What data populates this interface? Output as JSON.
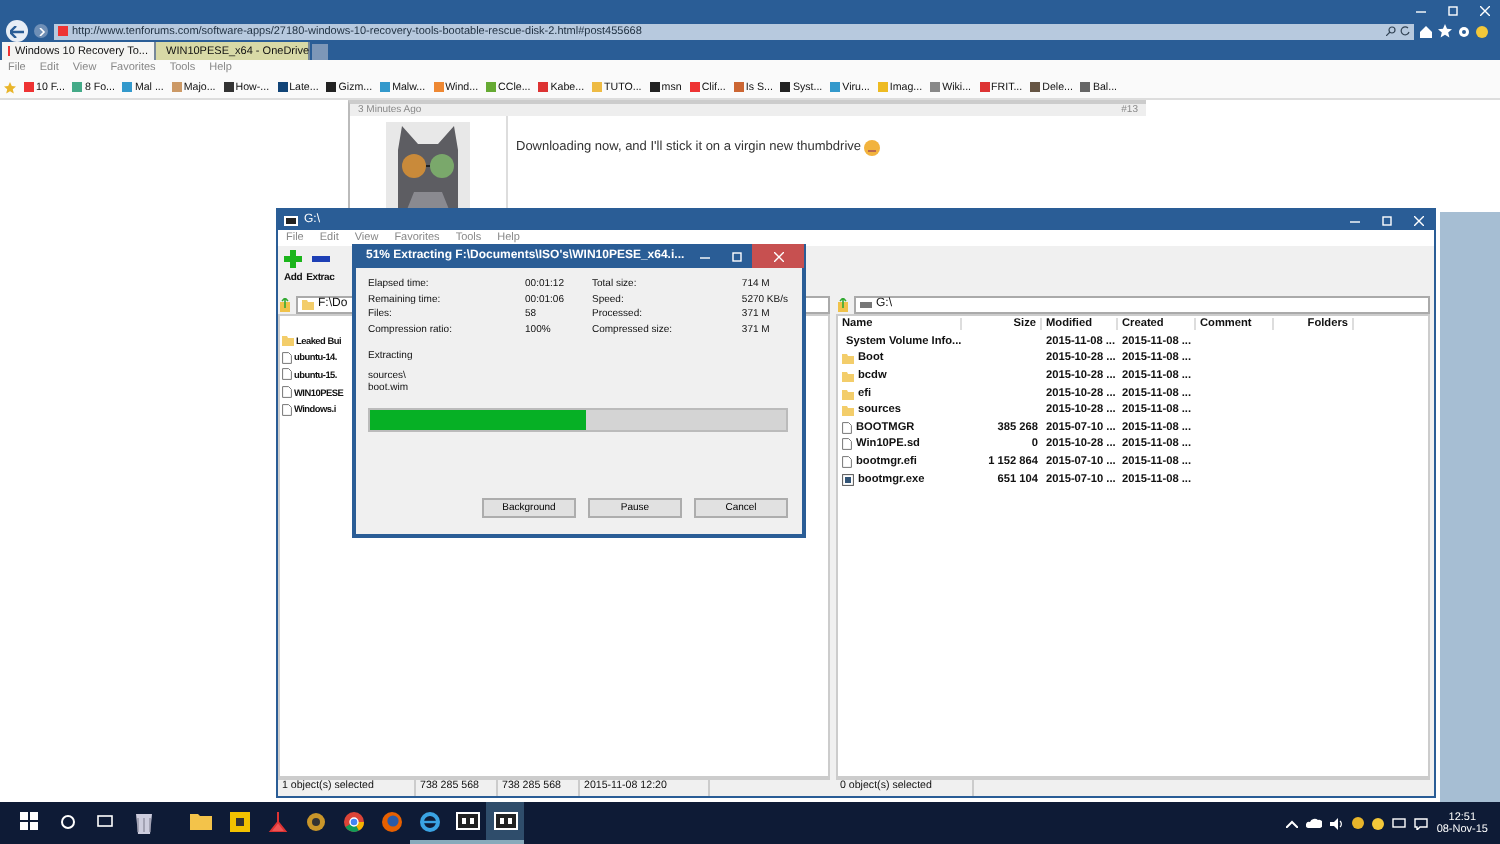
{
  "browser": {
    "url": "http://www.tenforums.com/software-apps/27180-windows-10-recovery-tools-bootable-rescue-disk-2.html#post455668",
    "tabs": [
      {
        "label": "Windows 10 Recovery To...",
        "selected": true
      },
      {
        "label": "WIN10PESE_x64 - OneDrive",
        "selected": false
      }
    ],
    "menu": [
      "File",
      "Edit",
      "View",
      "Favorites",
      "Tools",
      "Help"
    ],
    "favorites": [
      "10 F...",
      "8 Fo...",
      "Mal ...",
      "Majo...",
      "How-...",
      "Late...",
      "Gizm...",
      "Malw...",
      "Wind...",
      "CCle...",
      "Kabe...",
      "TUTO...",
      "msn",
      "Clif...",
      "Is S...",
      "Syst...",
      "Viru...",
      "Imag...",
      "Wiki...",
      "FRIT...",
      "Dele...",
      "Bal..."
    ],
    "post": {
      "time": "3 Minutes Ago",
      "number": "#13",
      "text": "Downloading now, and I'll stick it on a virgin new thumbdrive"
    }
  },
  "file_manager": {
    "title": "G:\\",
    "menu": [
      "File",
      "Edit",
      "View",
      "Favorites",
      "Tools",
      "Help"
    ],
    "toolbar": [
      "Add",
      "Extrac"
    ],
    "left_pane": {
      "path": "F:\\Do",
      "items": [
        {
          "name": "Leaked Bui",
          "kind": "folder"
        },
        {
          "name": "ubuntu-14.",
          "kind": "file"
        },
        {
          "name": "ubuntu-15.",
          "kind": "file"
        },
        {
          "name": "WIN10PESE",
          "kind": "file"
        },
        {
          "name": "Windows.i",
          "kind": "file"
        }
      ],
      "status": [
        "1 object(s) selected",
        "738 285 568",
        "738 285 568",
        "2015-11-08 12:20"
      ]
    },
    "right_pane": {
      "path": "G:\\",
      "columns": [
        "Name",
        "Size",
        "Modified",
        "Created",
        "Comment",
        "Folders"
      ],
      "rows": [
        {
          "name": "System Volume Info...",
          "size": "",
          "modified": "2015-11-08 ...",
          "created": "2015-11-08 ...",
          "kind": "system_folder"
        },
        {
          "name": "Boot",
          "size": "",
          "modified": "2015-10-28 ...",
          "created": "2015-11-08 ...",
          "kind": "folder"
        },
        {
          "name": "bcdw",
          "size": "",
          "modified": "2015-10-28 ...",
          "created": "2015-11-08 ...",
          "kind": "folder"
        },
        {
          "name": "efi",
          "size": "",
          "modified": "2015-10-28 ...",
          "created": "2015-11-08 ...",
          "kind": "folder"
        },
        {
          "name": "sources",
          "size": "",
          "modified": "2015-10-28 ...",
          "created": "2015-11-08 ...",
          "kind": "folder"
        },
        {
          "name": "BOOTMGR",
          "size": "385 268",
          "modified": "2015-07-10 ...",
          "created": "2015-11-08 ...",
          "kind": "file"
        },
        {
          "name": "Win10PE.sd",
          "size": "0",
          "modified": "2015-10-28 ...",
          "created": "2015-11-08 ...",
          "kind": "file"
        },
        {
          "name": "bootmgr.efi",
          "size": "1 152 864",
          "modified": "2015-07-10 ...",
          "created": "2015-11-08 ...",
          "kind": "file"
        },
        {
          "name": "bootmgr.exe",
          "size": "651 104",
          "modified": "2015-07-10 ...",
          "created": "2015-11-08 ...",
          "kind": "program"
        }
      ],
      "status": [
        "0 object(s) selected"
      ]
    }
  },
  "extract_dialog": {
    "title": "51% Extracting F:\\Documents\\ISO's\\WIN10PESE_x64.i...",
    "stats_left": [
      {
        "label": "Elapsed time:",
        "value": "00:01:12"
      },
      {
        "label": "Remaining time:",
        "value": "00:01:06"
      },
      {
        "label": "Files:",
        "value": "58"
      },
      {
        "label": "Compression ratio:",
        "value": "100%"
      }
    ],
    "stats_right": [
      {
        "label": "Total size:",
        "value": "714 M"
      },
      {
        "label": "Speed:",
        "value": "5270 KB/s"
      },
      {
        "label": "Processed:",
        "value": "371 M"
      },
      {
        "label": "Compressed size:",
        "value": "371 M"
      }
    ],
    "action": "Extracting",
    "path_lines": [
      "sources\\",
      "boot.wim"
    ],
    "level": 0.52,
    "buttons": [
      "Background",
      "Pause",
      "Cancel"
    ]
  },
  "taskbar": {
    "apps": [
      {
        "kind": "recycle",
        "running": false,
        "selected": false
      },
      {
        "kind": "folder",
        "running": false,
        "selected": false
      },
      {
        "kind": "tool",
        "running": false,
        "selected": false
      },
      {
        "kind": "cleaner",
        "running": false,
        "selected": false
      },
      {
        "kind": "gold",
        "running": false,
        "selected": false
      },
      {
        "kind": "chrome",
        "running": false,
        "selected": false
      },
      {
        "kind": "firefox",
        "running": false,
        "selected": false
      },
      {
        "kind": "ie",
        "running": true,
        "selected": false
      },
      {
        "kind": "zip",
        "running": true,
        "selected": false
      },
      {
        "kind": "zip",
        "running": true,
        "selected": true
      }
    ],
    "time": "12:51",
    "date": "08-Nov-15"
  }
}
